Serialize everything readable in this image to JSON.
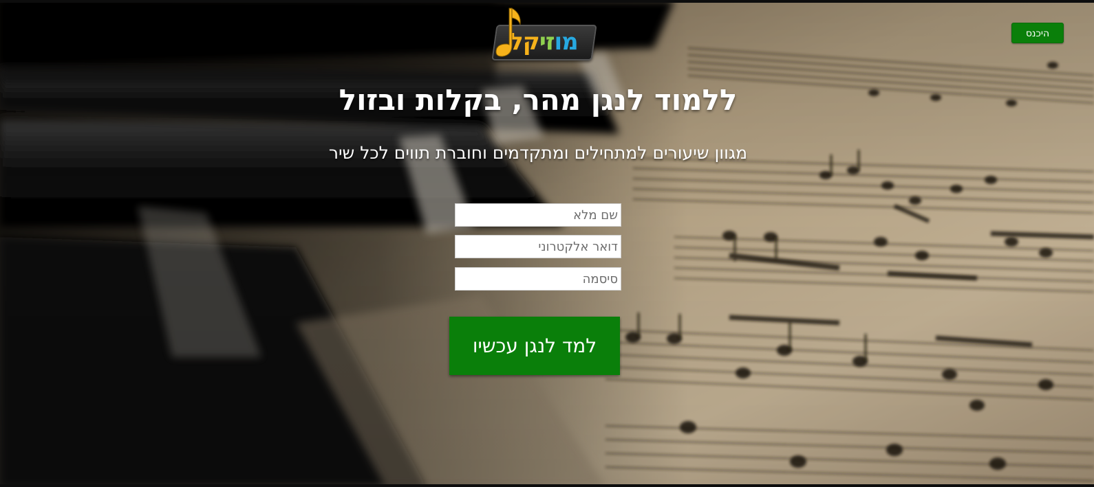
{
  "header": {
    "login_label": "היכנס",
    "logo_text_parts": [
      "מו",
      "זי",
      "קל"
    ]
  },
  "hero": {
    "headline": "ללמוד לנגן מהר, בקלות ובזול",
    "subheadline": "מגוון שיעורים למתחילים ומתקדמים וחוברת תווים לכל שיר"
  },
  "form": {
    "name_placeholder": "שם מלא",
    "email_placeholder": "דואר אלקטרוני",
    "password_placeholder": "סיסמה",
    "submit_label": "למד לנגן עכשיו"
  },
  "colors": {
    "accent_green": "#0a7f0a",
    "logo_green": "#8fd14f",
    "logo_yellow": "#f6b21b",
    "logo_blue": "#27a9e1",
    "text_white": "#ffffff"
  },
  "icons": {
    "logo_note": "music-note-icon"
  }
}
